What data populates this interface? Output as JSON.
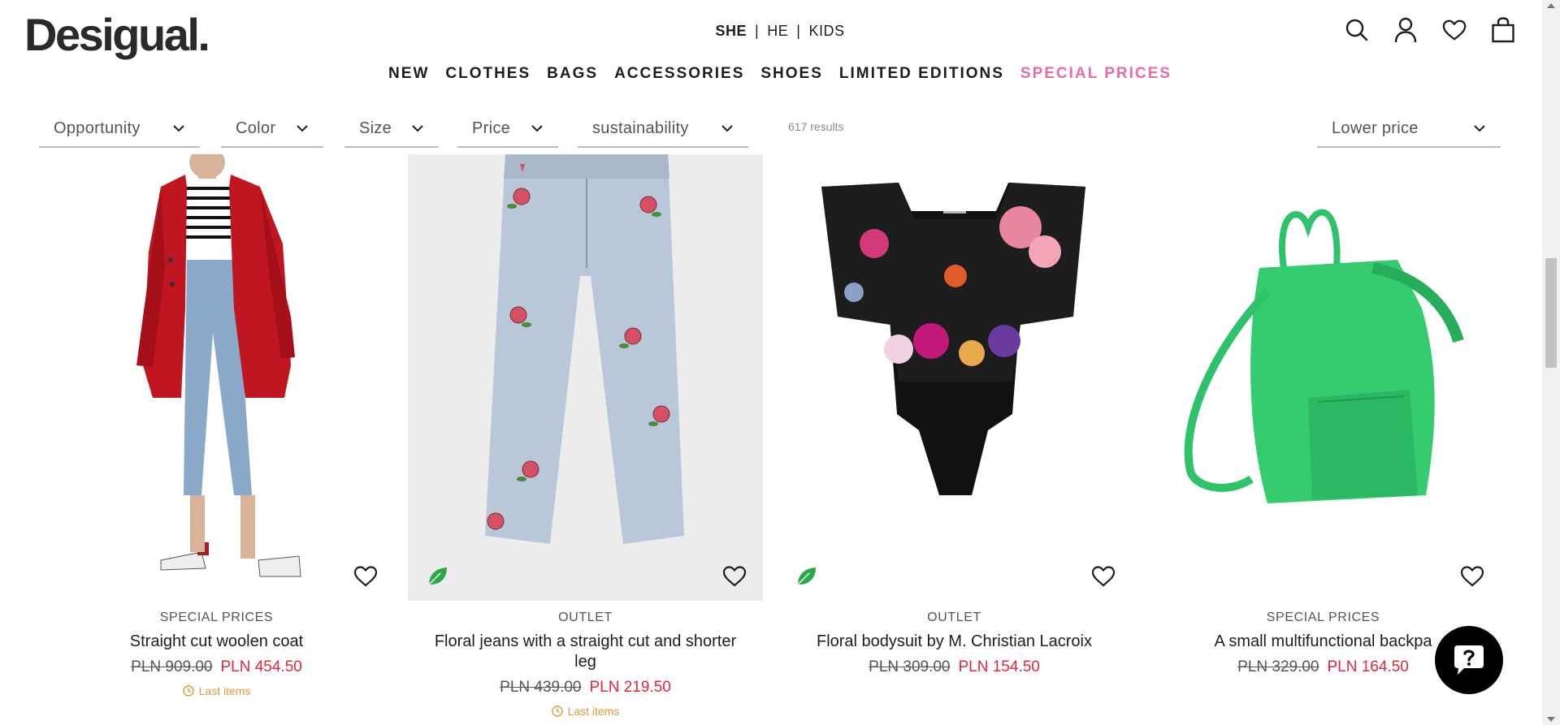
{
  "brand": {
    "logo_text": "Desigual."
  },
  "gender_nav": {
    "she": "SHE",
    "sep": "|",
    "he": "HE",
    "kids": "KIDS"
  },
  "main_nav": {
    "new": "NEW",
    "clothes": "CLOTHES",
    "bags": "BAGS",
    "accessories": "ACCESSORIES",
    "shoes": "SHOES",
    "limited": "LIMITED EDITIONS",
    "special": "SPECIAL PRICES"
  },
  "header_icons": [
    "search-icon",
    "user-icon",
    "heart-icon",
    "bag-icon"
  ],
  "filters": {
    "opportunity": "Opportunity",
    "color": "Color",
    "size": "Size",
    "price": "Price",
    "sustainability": "sustainability",
    "results": "617 results",
    "sort": "Lower price"
  },
  "colors": {
    "special_accent": "#e96ba8",
    "sale_price": "#e0273f",
    "last_items": "#e19a35",
    "eco_leaf": "#2aa84a"
  },
  "products": [
    {
      "tag": "SPECIAL PRICES",
      "name": "Straight cut woolen coat",
      "old_price": "PLN 909.00",
      "new_price": "PLN 454.50",
      "last": "Last items",
      "eco": false
    },
    {
      "tag": "OUTLET",
      "name": "Floral jeans with a straight cut and shorter leg",
      "old_price": "PLN 439.00",
      "new_price": "PLN 219.50",
      "last": "Last items",
      "eco": true
    },
    {
      "tag": "OUTLET",
      "name": "Floral bodysuit by M. Christian Lacroix",
      "old_price": "PLN 309.00",
      "new_price": "PLN 154.50",
      "last": "",
      "eco": true
    },
    {
      "tag": "SPECIAL PRICES",
      "name": "A small multifunctional backpa",
      "old_price": "PLN 329.00",
      "new_price": "PLN 164.50",
      "last": "",
      "eco": false
    }
  ]
}
